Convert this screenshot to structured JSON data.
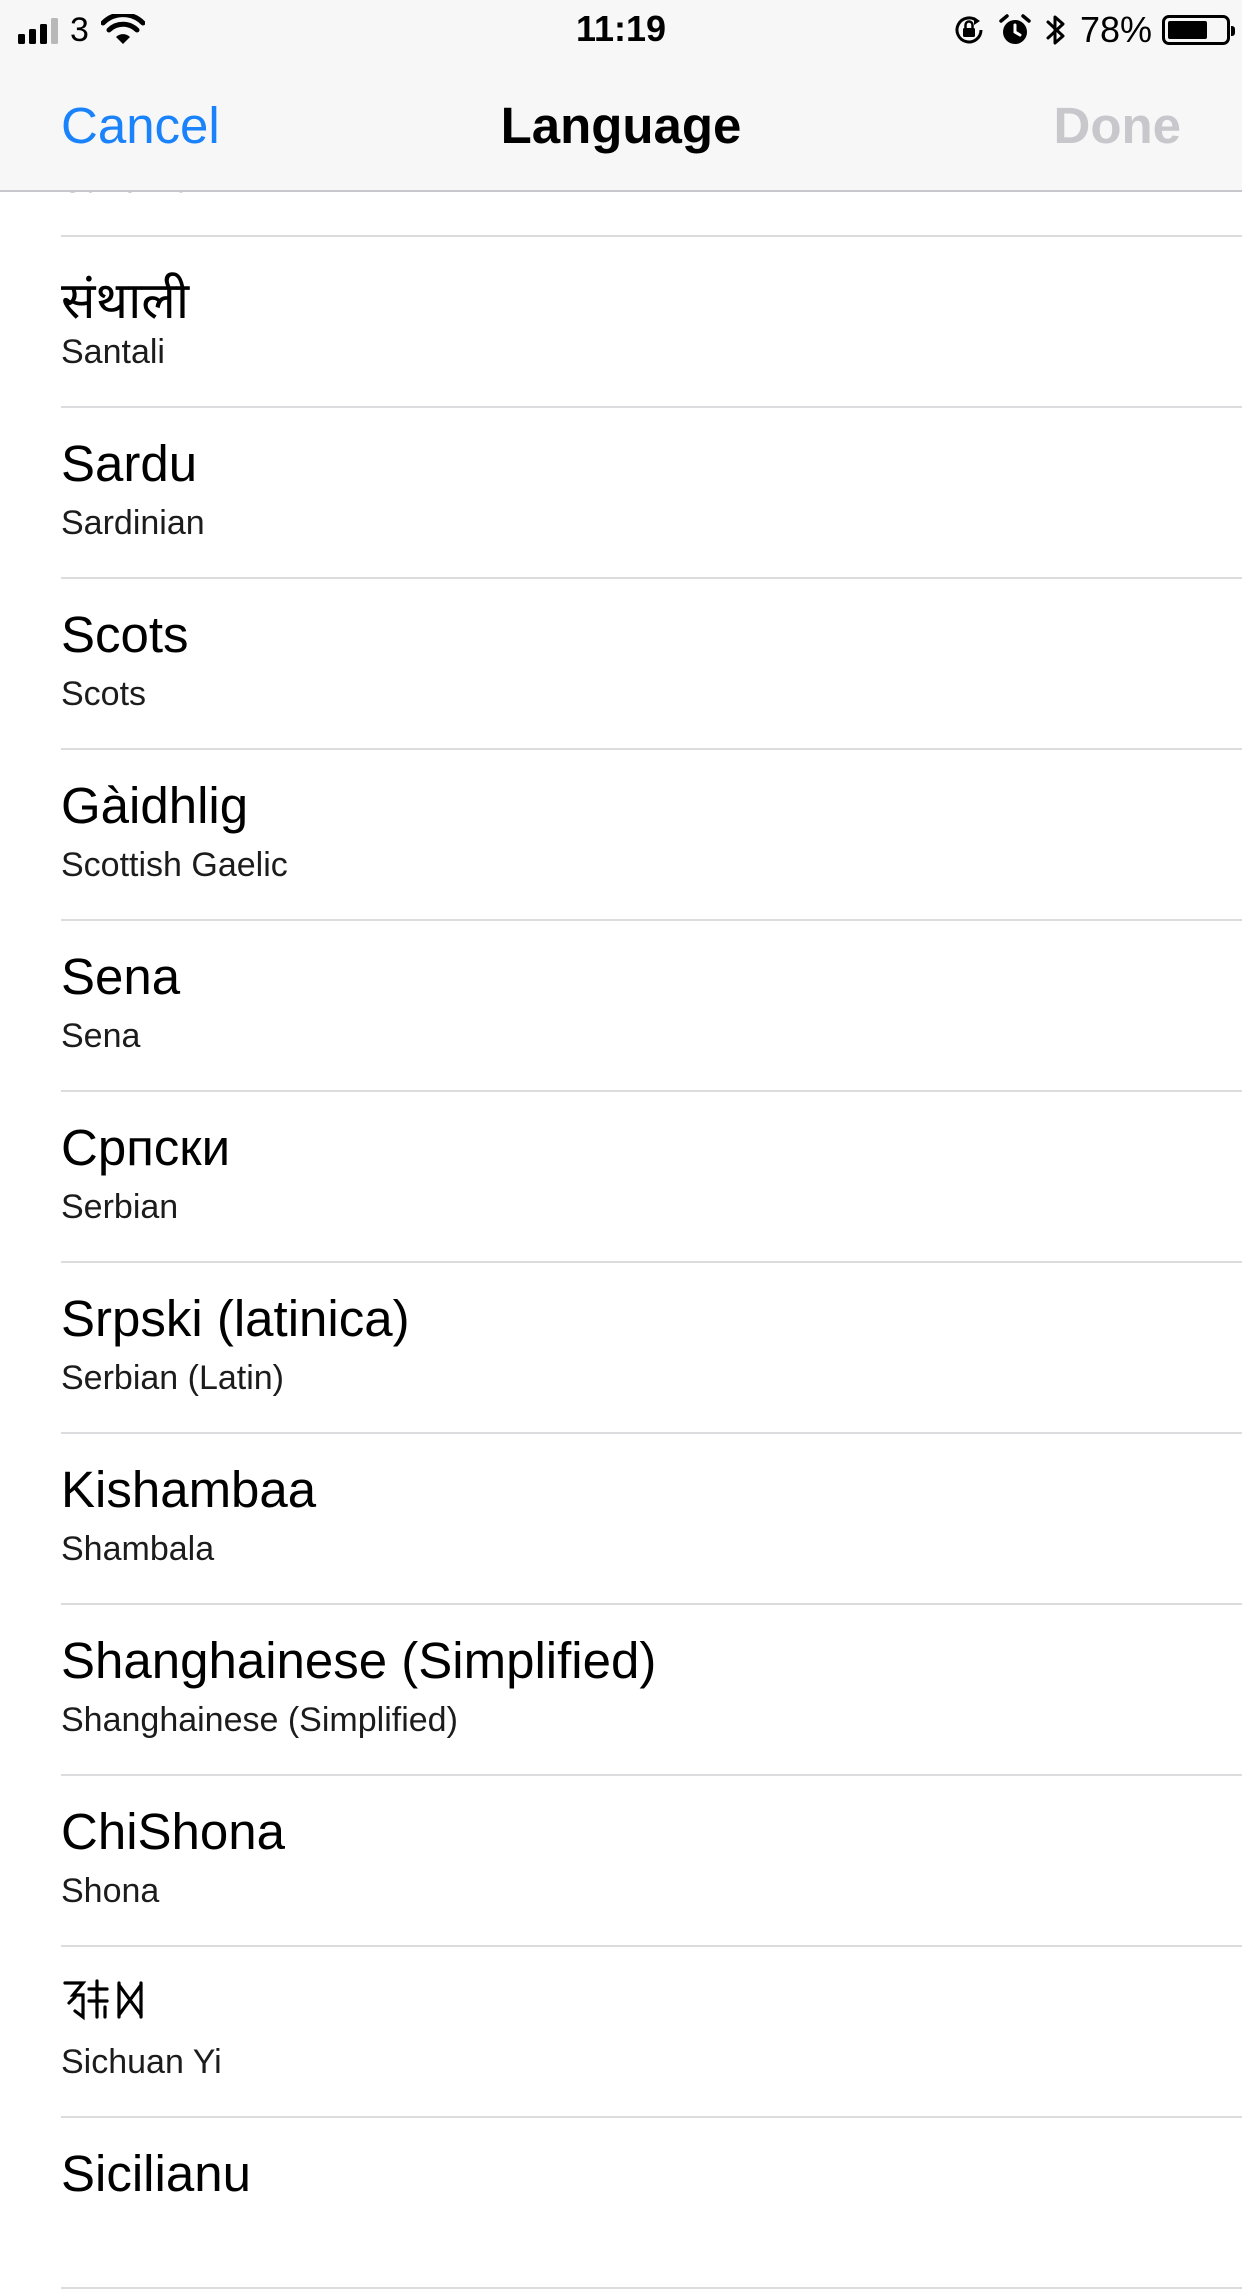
{
  "status_bar": {
    "carrier": "3",
    "time": "11:19",
    "battery": "78%",
    "battery_level": 0.78,
    "icons": [
      "signal-icon",
      "wifi-icon",
      "orientation-lock-icon",
      "alarm-icon",
      "bluetooth-icon",
      "battery-icon"
    ]
  },
  "nav": {
    "cancel": "Cancel",
    "title": "Language",
    "done": "Done",
    "cancel_color": "#1a82fb",
    "done_color": "#c7c7cc"
  },
  "languages": [
    {
      "native": "Sanskrit",
      "english": "Sanskrit"
    },
    {
      "native": "संथाली",
      "english": "Santali"
    },
    {
      "native": "Sardu",
      "english": "Sardinian"
    },
    {
      "native": "Scots",
      "english": "Scots"
    },
    {
      "native": "Gàidhlig",
      "english": "Scottish Gaelic"
    },
    {
      "native": "Sena",
      "english": "Sena"
    },
    {
      "native": "Српски",
      "english": "Serbian"
    },
    {
      "native": "Srpski (latinica)",
      "english": "Serbian (Latin)"
    },
    {
      "native": "Kishambaa",
      "english": "Shambala"
    },
    {
      "native": "Shanghainese (Simplified)",
      "english": "Shanghainese (Simplified)"
    },
    {
      "native": "ChiShona",
      "english": "Shona"
    },
    {
      "native": "ꆈꌠꉙ",
      "english": "Sichuan Yi",
      "native_is_glyph": true
    },
    {
      "native": "Sicilianu",
      "english": ""
    }
  ]
}
